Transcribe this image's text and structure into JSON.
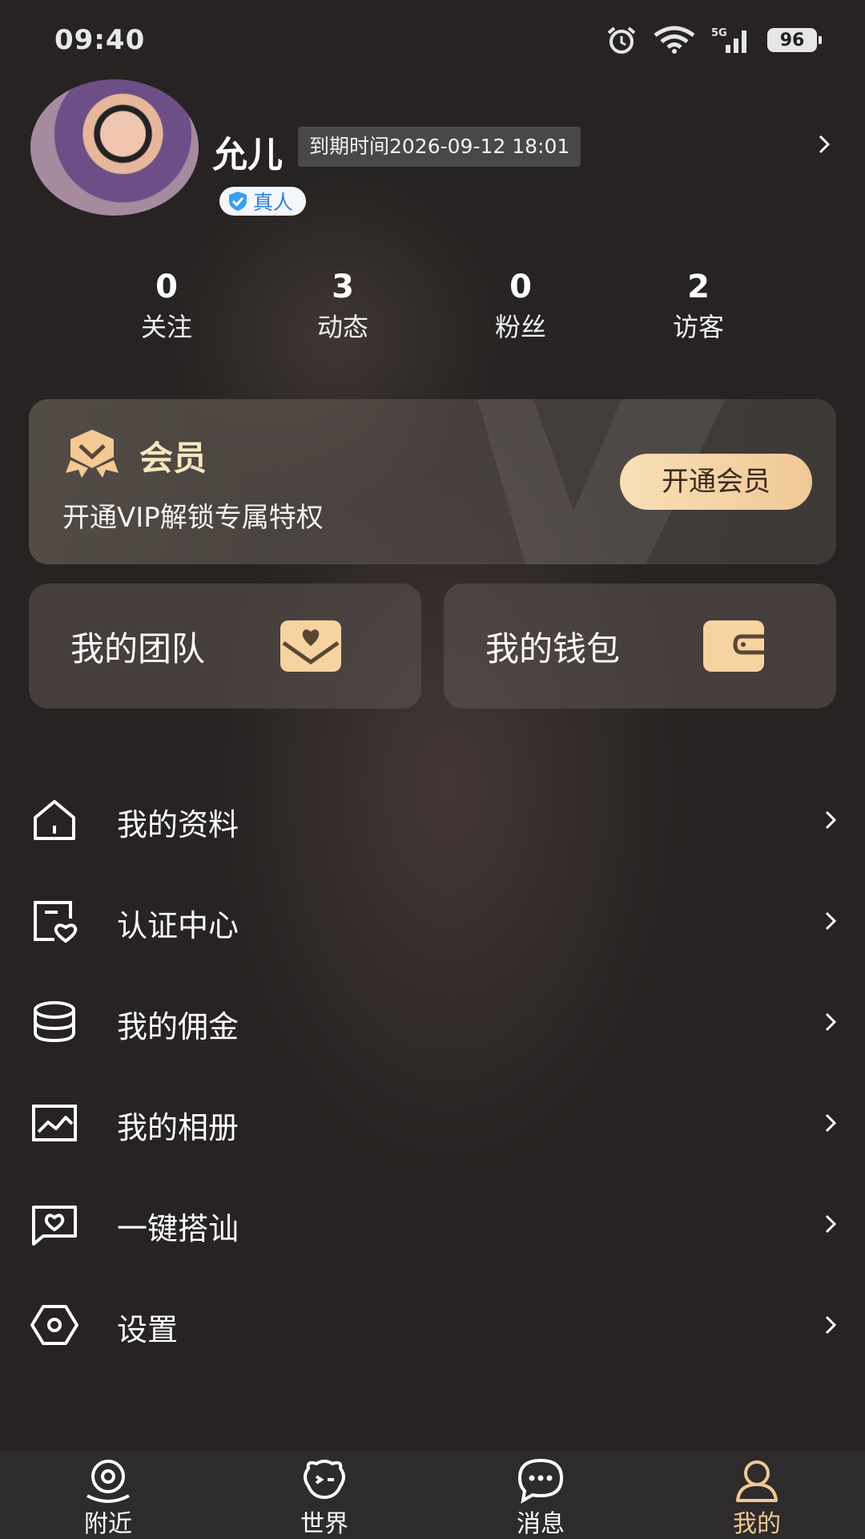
{
  "status_bar": {
    "time": "09:40",
    "network": "5G",
    "battery": "96"
  },
  "profile": {
    "nickname": "允儿",
    "expire_text": "到期时间2026-09-12 18:01",
    "badge": "真人"
  },
  "stats": [
    {
      "value": "0",
      "label": "关注"
    },
    {
      "value": "3",
      "label": "动态"
    },
    {
      "value": "0",
      "label": "粉丝"
    },
    {
      "value": "2",
      "label": "访客"
    }
  ],
  "vip": {
    "title": "会员",
    "subtitle": "开通VIP解锁专属特权",
    "button": "开通会员"
  },
  "features": [
    {
      "label": "我的团队",
      "icon": "heart-envelope-icon"
    },
    {
      "label": "我的钱包",
      "icon": "wallet-icon"
    }
  ],
  "menu": [
    {
      "label": "我的资料",
      "icon": "home-icon"
    },
    {
      "label": "认证中心",
      "icon": "certificate-heart-icon"
    },
    {
      "label": "我的佣金",
      "icon": "coins-stack-icon"
    },
    {
      "label": "我的相册",
      "icon": "photo-album-icon"
    },
    {
      "label": "一键搭讪",
      "icon": "heart-chat-icon"
    },
    {
      "label": "设置",
      "icon": "settings-icon"
    }
  ],
  "tabbar": {
    "tabs": [
      {
        "label": "附近",
        "icon": "location-face-icon"
      },
      {
        "label": "世界",
        "icon": "world-bubble-icon"
      },
      {
        "label": "消息",
        "icon": "message-icon"
      },
      {
        "label": "我的",
        "icon": "profile-icon"
      }
    ],
    "active_color": "#f1c892"
  }
}
